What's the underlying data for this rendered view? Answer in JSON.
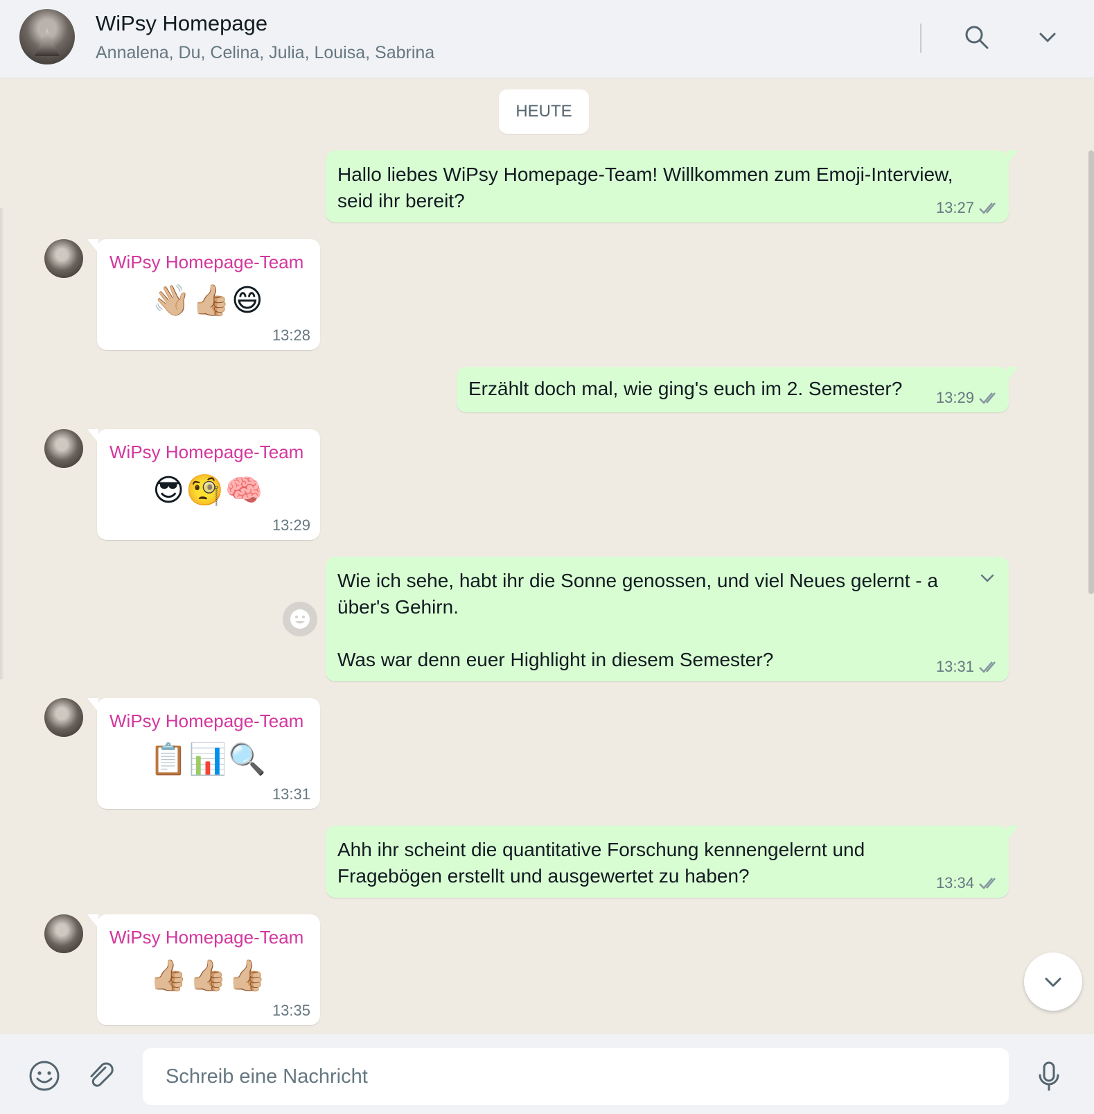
{
  "header": {
    "title": "WiPsy Homepage",
    "participants": "Annalena, Du, Celina, Julia, Louisa, Sabrina"
  },
  "date_label": "HEUTE",
  "messages": [
    {
      "direction": "out",
      "text": "Hallo liebes WiPsy Homepage-Team! Willkommen zum Emoji-Interview,\nseid ihr bereit?",
      "time": "13:27",
      "status": "read"
    },
    {
      "direction": "in",
      "sender": "WiPsy Homepage-Team",
      "text": "👋🏼👍🏼😄",
      "time": "13:28"
    },
    {
      "direction": "out",
      "text": "Erzählt doch mal, wie ging's euch im 2. Semester?",
      "time": "13:29",
      "status": "read"
    },
    {
      "direction": "in",
      "sender": "WiPsy Homepage-Team",
      "text": "😎🧐🧠",
      "time": "13:29"
    },
    {
      "direction": "out",
      "text": "Wie ich sehe, habt ihr die Sonne genossen, und viel Neues gelernt - a\nüber's Gehirn.\n\nWas war denn euer Highlight in diesem Semester?",
      "time": "13:31",
      "status": "read"
    },
    {
      "direction": "in",
      "sender": "WiPsy Homepage-Team",
      "text": "📋📊🔍",
      "time": "13:31"
    },
    {
      "direction": "out",
      "text": "Ahh ihr scheint die quantitative Forschung kennengelernt und\nFragebögen erstellt und ausgewertet zu haben?",
      "time": "13:34",
      "status": "read"
    },
    {
      "direction": "in",
      "sender": "WiPsy Homepage-Team",
      "text": "👍🏼👍🏼👍🏼",
      "time": "13:35"
    }
  ],
  "composer": {
    "placeholder": "Schreib eine Nachricht"
  },
  "colors": {
    "outgoing_bubble": "#d9fdd3",
    "incoming_bubble": "#ffffff",
    "sender_name": "#d3379d",
    "chat_background": "#efeae2",
    "read_ticks": "#8696a0"
  },
  "icons": {
    "header": [
      "search-icon",
      "chevron-down-icon"
    ],
    "footer": [
      "emoji-icon",
      "paperclip-icon",
      "microphone-icon"
    ],
    "chat": [
      "reaction-smiley-icon",
      "message-menu-chevron-icon",
      "scroll-down-chevron-icon"
    ]
  }
}
